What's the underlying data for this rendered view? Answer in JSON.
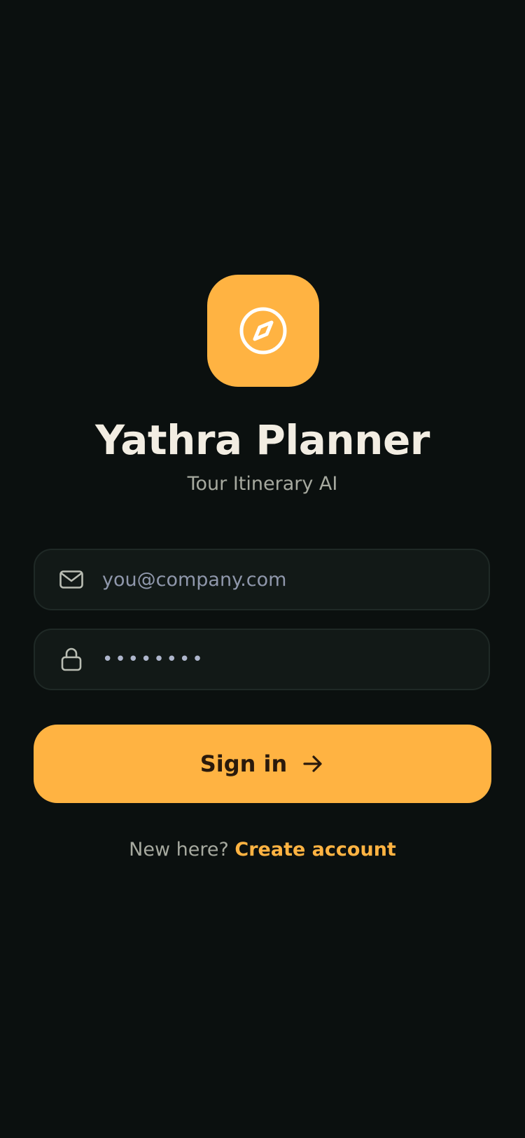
{
  "app": {
    "title": "Yathra Planner",
    "subtitle": "Tour Itinerary AI",
    "icon": "compass-icon"
  },
  "form": {
    "email": {
      "placeholder": "you@company.com",
      "value": "",
      "icon": "mail-icon"
    },
    "password": {
      "value": "••••••••",
      "icon": "lock-icon"
    },
    "submit_label": "Sign in",
    "submit_icon": "arrow-right-icon"
  },
  "footer": {
    "prompt": "New here?",
    "link_label": "Create account"
  },
  "colors": {
    "background": "#0b100f",
    "accent": "#ffb342",
    "field_bg": "#121917",
    "title_text": "#f2ede2",
    "muted_text": "#a6a99f"
  }
}
